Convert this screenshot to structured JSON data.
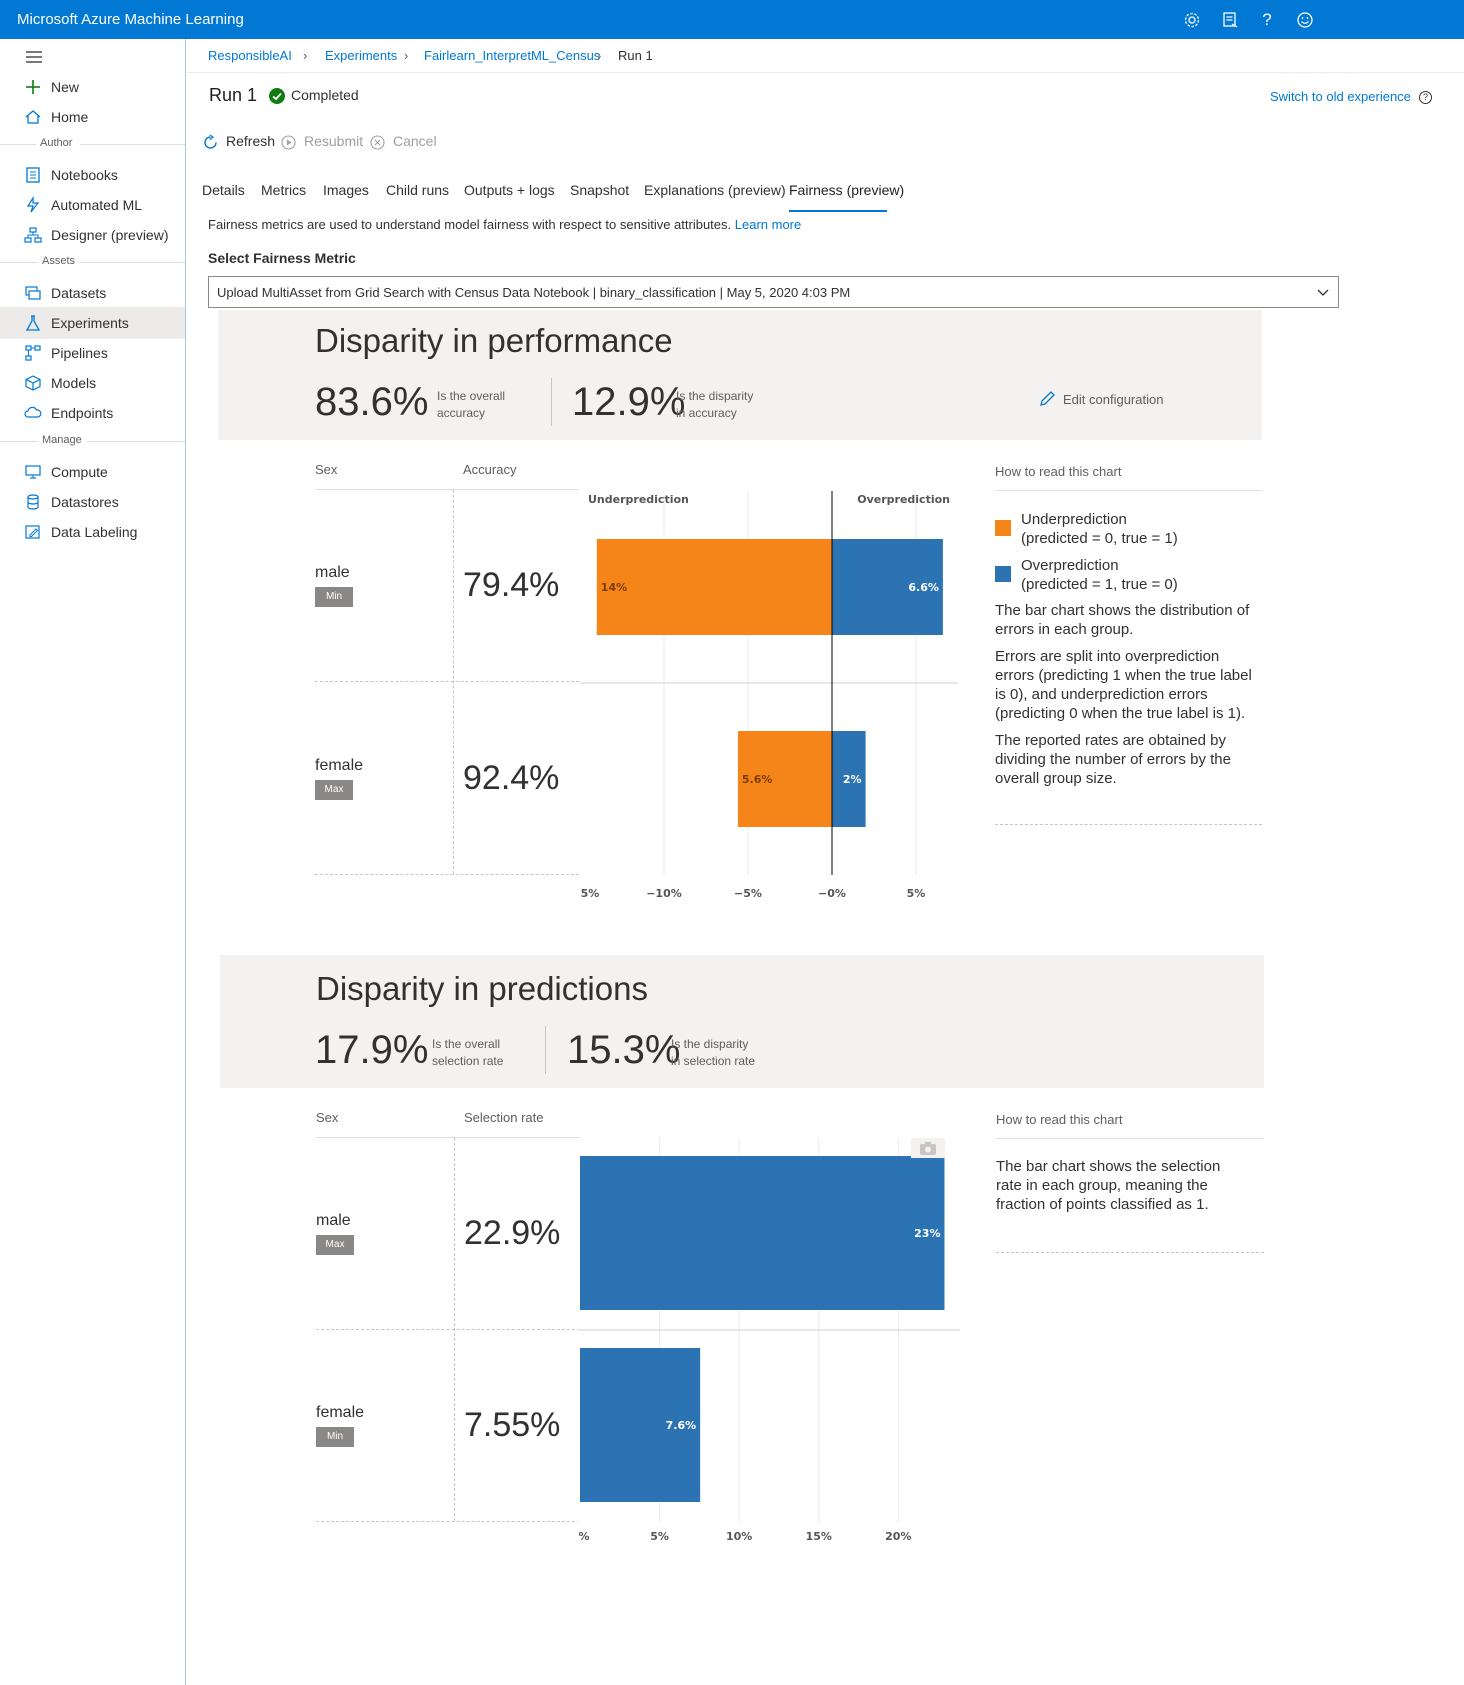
{
  "app": {
    "title": "Microsoft Azure Machine Learning"
  },
  "topbar_icons": [
    "gear-icon",
    "feedback-icon",
    "help-icon",
    "smiley-icon"
  ],
  "sidebar": {
    "items": [
      {
        "label": "New",
        "icon": "plus-icon"
      },
      {
        "label": "Home",
        "icon": "home-icon"
      },
      {
        "label": "Notebooks",
        "icon": "notebook-icon"
      },
      {
        "label": "Automated ML",
        "icon": "automl-icon"
      },
      {
        "label": "Designer (preview)",
        "icon": "designer-icon"
      },
      {
        "label": "Datasets",
        "icon": "datasets-icon"
      },
      {
        "label": "Experiments",
        "icon": "flask-icon"
      },
      {
        "label": "Pipelines",
        "icon": "pipelines-icon"
      },
      {
        "label": "Models",
        "icon": "cube-icon"
      },
      {
        "label": "Endpoints",
        "icon": "cloud-icon"
      },
      {
        "label": "Compute",
        "icon": "monitor-icon"
      },
      {
        "label": "Datastores",
        "icon": "database-icon"
      },
      {
        "label": "Data Labeling",
        "icon": "labeling-icon"
      }
    ],
    "sections": {
      "author": "Author",
      "assets": "Assets",
      "manage": "Manage"
    },
    "active": "Experiments"
  },
  "breadcrumb": [
    "ResponsibleAI",
    "Experiments",
    "Fairlearn_InterpretML_Census",
    "Run 1"
  ],
  "run": {
    "title": "Run 1",
    "status": "Completed",
    "switch_link": "Switch to old experience",
    "help_glyph": "?"
  },
  "commands": {
    "refresh": "Refresh",
    "resubmit": "Resubmit",
    "cancel": "Cancel"
  },
  "tabs": [
    "Details",
    "Metrics",
    "Images",
    "Child runs",
    "Outputs + logs",
    "Snapshot",
    "Explanations (preview)",
    "Fairness (preview)"
  ],
  "active_tab": "Fairness (preview)",
  "fairness": {
    "description": "Fairness metrics are used to understand model fairness with respect to sensitive attributes.",
    "learn_more": "Learn more",
    "select_label": "Select Fairness Metric",
    "selected_model": "Upload MultiAsset from Grid Search with Census Data Notebook | binary_classification | May 5, 2020 4:03 PM"
  },
  "performance": {
    "title": "Disparity in performance",
    "overall_value": "83.6%",
    "overall_desc": "Is the overall accuracy",
    "disparity_value": "12.9%",
    "disparity_desc": "Is the disparity in accuracy",
    "edit_config": "Edit configuration",
    "col_feature": "Sex",
    "col_metric": "Accuracy",
    "how_to_read": "How to read this chart",
    "legend": [
      {
        "label": "Underprediction\n(predicted = 0, true = 1)",
        "color": "#f58518"
      },
      {
        "label": "Overprediction\n(predicted = 1, true = 0)",
        "color": "#2c73b4"
      }
    ],
    "paragraphs": [
      "The bar chart shows the distribution of errors in each group.",
      "Errors are split into overprediction errors (predicting 1 when the true label is 0), and underprediction errors (predicting 0 when the true label is 1).",
      "The reported rates are obtained by dividing the number of errors by the overall group size."
    ],
    "groups": [
      {
        "name": "male",
        "badge": "Min",
        "value": "79.4%"
      },
      {
        "name": "female",
        "badge": "Max",
        "value": "92.4%"
      }
    ]
  },
  "predictions": {
    "title": "Disparity in predictions",
    "overall_value": "17.9%",
    "overall_desc": "Is the overall selection rate",
    "disparity_value": "15.3%",
    "disparity_desc": "Is the disparity in selection rate",
    "col_feature": "Sex",
    "col_metric": "Selection rate",
    "how_to_read": "How to read this chart",
    "paragraphs": [
      "The bar chart shows the selection rate in each group, meaning the fraction of points classified as 1."
    ],
    "groups": [
      {
        "name": "male",
        "badge": "Max",
        "value": "22.9%"
      },
      {
        "name": "female",
        "badge": "Min",
        "value": "7.55%"
      }
    ]
  },
  "chart_data": [
    {
      "type": "bar",
      "orientation": "horizontal",
      "stacked": "diverging",
      "categories": [
        "male",
        "female"
      ],
      "series": [
        {
          "name": "Underprediction",
          "values": [
            -14,
            -5.6
          ],
          "labels": [
            "14%",
            "5.6%"
          ],
          "color": "#f58518"
        },
        {
          "name": "Overprediction",
          "values": [
            6.6,
            2
          ],
          "labels": [
            "6.6%",
            "2%"
          ],
          "color": "#2c73b4"
        }
      ],
      "xlim": [
        -15,
        7.5
      ],
      "x_ticks": [
        -15,
        -10,
        -5,
        0,
        5
      ],
      "x_tick_labels": [
        "5%",
        "−10%",
        "−5%",
        "−0%",
        "5%"
      ],
      "zero_line": 0,
      "header_left": "Underprediction",
      "header_right": "Overprediction",
      "grid": true
    },
    {
      "type": "bar",
      "orientation": "horizontal",
      "categories": [
        "male",
        "female"
      ],
      "series": [
        {
          "values": [
            22.9,
            7.55
          ],
          "labels": [
            "23%",
            "7.6%"
          ],
          "color": "#2c73b4"
        }
      ],
      "xlim": [
        0,
        24
      ],
      "x_ticks": [
        0,
        5,
        10,
        15,
        20
      ],
      "x_tick_labels": [
        "%",
        "5%",
        "10%",
        "15%",
        "20%"
      ],
      "grid": true
    }
  ]
}
